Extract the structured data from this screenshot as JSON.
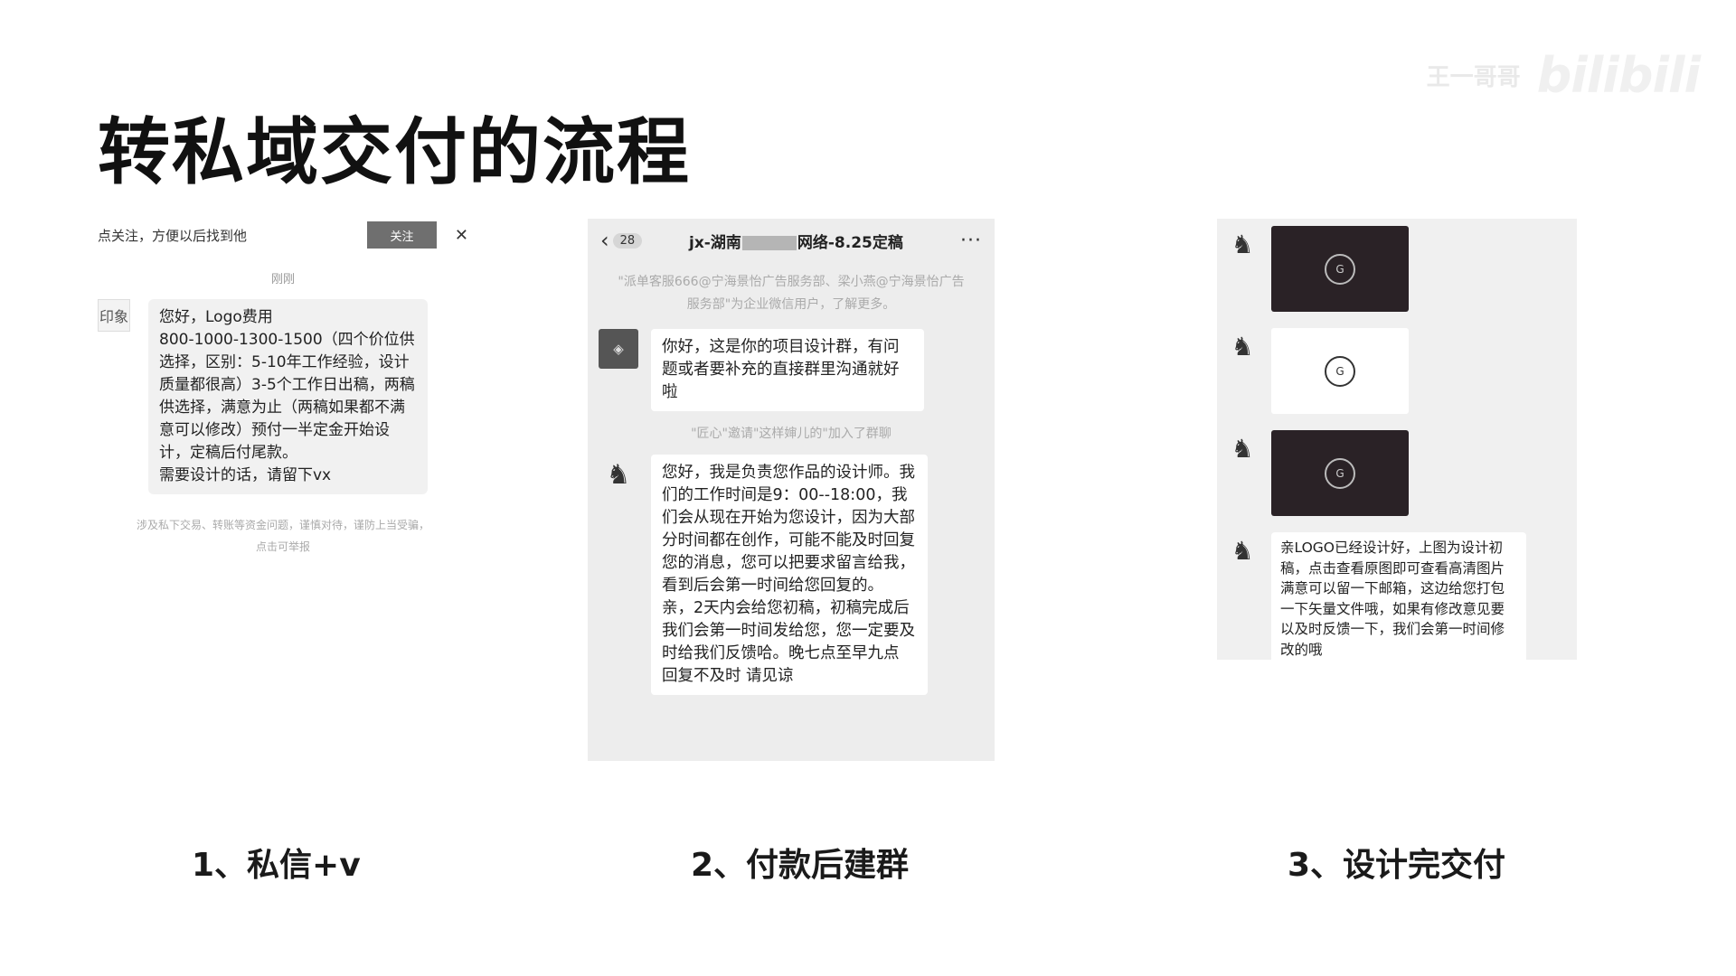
{
  "watermark": {
    "text": "王一哥哥",
    "logo": "bilibili"
  },
  "title": "转私域交付的流程",
  "panel1": {
    "follow_text": "点关注，方便以后找到他",
    "follow_button": "关注",
    "close_glyph": "✕",
    "time": "刚刚",
    "avatar_glyph": "印象",
    "message": "您好，Logo费用\n800-1000-1300-1500（四个价位供选择，区别：5-10年工作经验，设计质量都很高）3-5个工作日出稿，两稿供选择，满意为止（两稿如果都不满意可以修改）预付一半定金开始设计，定稿后付尾款。\n需要设计的话，请留下vx",
    "notice": "涉及私下交易、转账等资金问题，谨慎对待，谨防上当受骗，\n点击可举报"
  },
  "panel2": {
    "back_glyph": "‹",
    "unread_count": "28",
    "group_title_prefix": "jx-湖南",
    "group_title_suffix": "网络-8.25定稿",
    "more_glyph": "···",
    "system_notice": "\"派单客服666@宁海景怡广告服务部、梁小燕@宁海景怡广告服务部\"为企业微信用户，了解更多。",
    "message_1": "你好，这是你的项目设计群，有问题或者要补充的直接群里沟通就好啦",
    "join_notice": "\"匠心\"邀请\"这样婶儿的\"加入了群聊",
    "message_2": "您好，我是负责您作品的设计师。我们的工作时间是9：00--18:00，我们会从现在开始为您设计，因为大部分时间都在创作，可能不能及时回复您的消息，您可以把要求留言给我，看到后会第一时间给您回复的。\n亲，2天内会给您初稿，初稿完成后我们会第一时间发给您，您一定要及时给我们反馈哈。晚七点至早九点 回复不及时 请见谅"
  },
  "panel3": {
    "image_cards": [
      {
        "theme": "dark",
        "mark": "G"
      },
      {
        "theme": "light",
        "mark": "G"
      },
      {
        "theme": "dark",
        "mark": "G"
      }
    ],
    "message": "亲LOGO已经设计好，上图为设计初稿，点击查看原图即可查看高清图片满意可以留一下邮箱，这边给您打包一下矢量文件哦，如果有修改意见要以及时反馈一下，我们会第一时间修改的哦"
  },
  "captions": [
    "1、私信+v",
    "2、付款后建群",
    "3、设计完交付"
  ],
  "icons": {
    "close": "close-icon",
    "back": "chevron-left-icon",
    "more": "more-icon",
    "avatar_figure": "figure-avatar-icon"
  }
}
